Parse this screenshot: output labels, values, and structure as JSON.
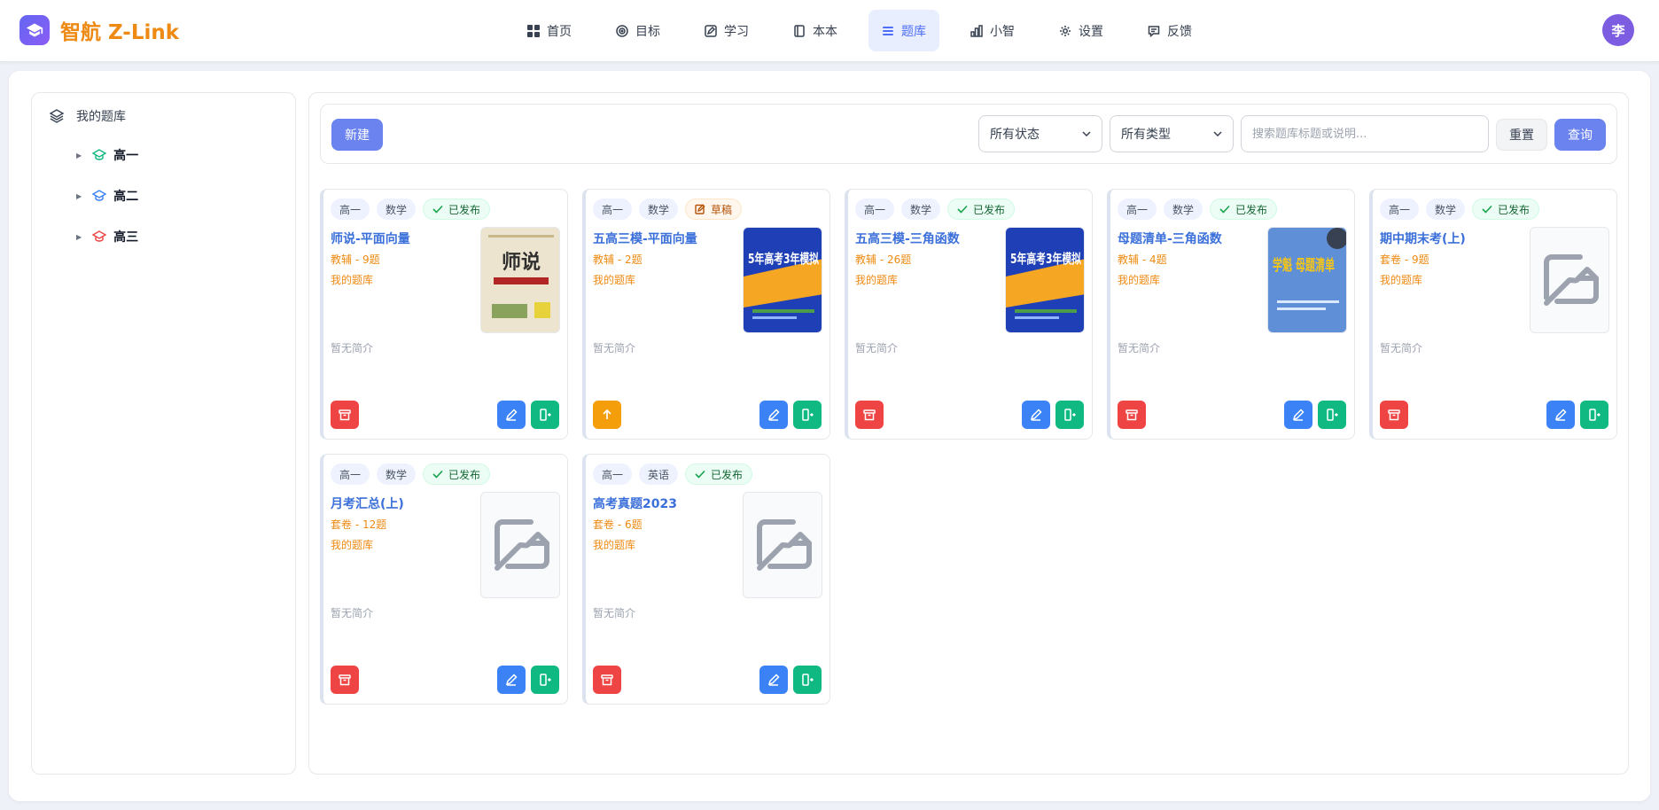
{
  "app": {
    "name": "智航 Z-Link",
    "avatar_text": "李"
  },
  "nav": [
    {
      "label": "首页",
      "icon": "grid-icon"
    },
    {
      "label": "目标",
      "icon": "target-icon"
    },
    {
      "label": "学习",
      "icon": "edit-icon"
    },
    {
      "label": "本本",
      "icon": "notebook-icon"
    },
    {
      "label": "题库",
      "icon": "list-icon",
      "active": true
    },
    {
      "label": "小智",
      "icon": "bar-chart-icon"
    },
    {
      "label": "设置",
      "icon": "gear-icon"
    },
    {
      "label": "反馈",
      "icon": "message-icon"
    }
  ],
  "sidebar": {
    "root_label": "我的题库",
    "items": [
      "高一",
      "高二",
      "高三"
    ]
  },
  "toolbar": {
    "new_label": "新建",
    "status_select": "所有状态",
    "type_select": "所有类型",
    "search_placeholder": "搜索题库标题或说明...",
    "reset_label": "重置",
    "query_label": "查询"
  },
  "cards": [
    {
      "grade": "高一",
      "subject": "数学",
      "status": "已发布",
      "title": "师说-平面向量",
      "meta": "教辅 - 9题",
      "lib": "我的题库",
      "desc": "暂无简介",
      "cover": "师说"
    },
    {
      "grade": "高一",
      "subject": "数学",
      "status": "草稿",
      "title": "五高三模-平面向量",
      "meta": "教辅 - 2题",
      "lib": "我的题库",
      "desc": "暂无简介",
      "cover": "5年高考3年模拟"
    },
    {
      "grade": "高一",
      "subject": "数学",
      "status": "已发布",
      "title": "五高三模-三角函数",
      "meta": "教辅 - 26题",
      "lib": "我的题库",
      "desc": "暂无简介",
      "cover": "5年高考3年模拟"
    },
    {
      "grade": "高一",
      "subject": "数学",
      "status": "已发布",
      "title": "母题清单-三角函数",
      "meta": "教辅 - 4题",
      "lib": "我的题库",
      "desc": "暂无简介",
      "cover": "学魁 母题清单"
    },
    {
      "grade": "高一",
      "subject": "数学",
      "status": "已发布",
      "title": "期中期末考(上)",
      "meta": "套卷 - 9题",
      "lib": "我的题库",
      "desc": "暂无简介",
      "cover": ""
    },
    {
      "grade": "高一",
      "subject": "数学",
      "status": "已发布",
      "title": "月考汇总(上)",
      "meta": "套卷 - 12题",
      "lib": "我的题库",
      "desc": "暂无简介",
      "cover": ""
    },
    {
      "grade": "高一",
      "subject": "英语",
      "status": "已发布",
      "title": "高考真题2023",
      "meta": "套卷 - 6题",
      "lib": "我的题库",
      "desc": "暂无简介",
      "cover": ""
    }
  ],
  "colors": {
    "accent": "#6b83ee",
    "brand_orange": "#ee8a13",
    "title_blue": "#3b6fd9",
    "delete_red": "#ef4444",
    "edit_blue": "#3b82f6",
    "exit_green": "#10b981",
    "publish_orange": "#f59e0b"
  }
}
